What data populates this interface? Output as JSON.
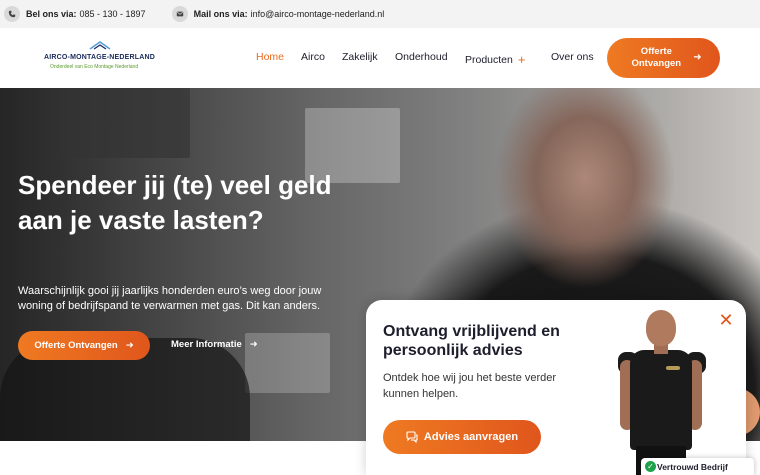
{
  "topbar": {
    "phone_label": "Bel ons via:",
    "phone_value": "085 - 130 - 1897",
    "mail_label": "Mail ons via:",
    "mail_value": "info@airco-montage-nederland.nl"
  },
  "logo": {
    "title": "AIRCO-MONTAGE-NEDERLAND",
    "subtitle": "Onderdeel van Eco Montage Nederland"
  },
  "nav": {
    "items": [
      {
        "label": "Home",
        "active": true
      },
      {
        "label": "Airco",
        "active": false
      },
      {
        "label": "Zakelijk",
        "active": false
      },
      {
        "label": "Onderhoud",
        "active": false
      },
      {
        "label": "Producten",
        "active": false
      },
      {
        "label": "Over ons",
        "active": false
      }
    ],
    "products_plus": "+",
    "cta": "Offerte Ontvangen"
  },
  "hero": {
    "title": "Spendeer jij (te) veel geld aan je vaste lasten?",
    "text": "Waarschijnlijk gooi jij jaarlijks honderden euro’s weg door jouw woning of bedrijfspand te verwarmen met gas. Dit kan anders.",
    "cta": "Offerte Ontvangen",
    "more": "Meer Informatie"
  },
  "popup": {
    "title": "Ontvang vrijblijvend en persoonlijk advies",
    "text": "Ontdek hoe wij jou het beste verder kunnen helpen.",
    "cta": "Advies aanvragen",
    "close": "✕"
  },
  "badge": {
    "label": "Vertrouwd Bedrijf"
  },
  "colors": {
    "accent": "#ea6a1e",
    "accent_gradient_start": "#ef7a22",
    "accent_gradient_end": "#e0561c",
    "text_dark": "#1d1d2c",
    "badge_green": "#1ea24a"
  },
  "icons": {
    "phone": "phone-icon",
    "mail": "mail-icon",
    "arrow": "arrow-right-icon",
    "chat": "chat-icon",
    "close": "close-icon",
    "check": "check-icon",
    "play": "play-icon"
  }
}
